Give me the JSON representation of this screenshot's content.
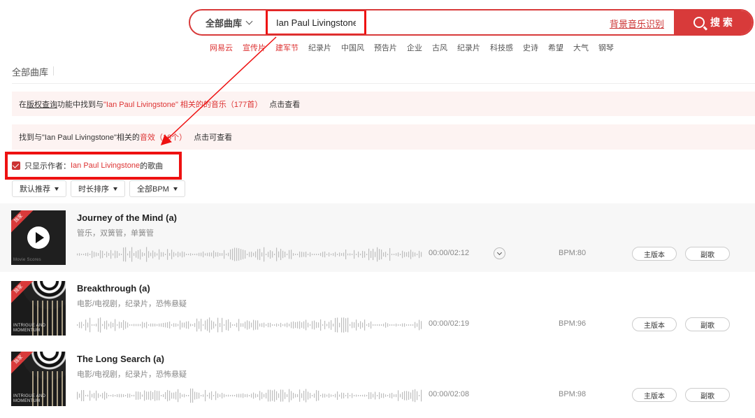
{
  "search": {
    "library_label": "全部曲库",
    "query": "Ian Paul Livingstone",
    "beat_link": "背景音乐识别",
    "button_label": "搜 索"
  },
  "hot_tags": [
    "网易云",
    "宣传片",
    "建军节",
    "纪录片",
    "中国风",
    "预告片",
    "企业",
    "古风",
    "纪录片",
    "科技感",
    "史诗",
    "希望",
    "大气",
    "钢琴"
  ],
  "section_title": "全部曲库",
  "notice_copyright": {
    "prefix": "在 ",
    "link": "版权查询",
    "middle": " 功能中找到与 ",
    "highlight": "\"Ian Paul Livingstone\" 相关的的音乐（177首）",
    "action": "点击查看"
  },
  "notice_sfx": {
    "prefix": "找到与\"Ian Paul Livingstone\"相关的 ",
    "highlight": "音效（16个）",
    "action": "点击可查看"
  },
  "only_author": {
    "prefix": "只显示作者：",
    "author": "Ian Paul Livingstone",
    "suffix": "的歌曲",
    "checked": true
  },
  "filters": [
    "默认推荐",
    "时长排序",
    "全部BPM"
  ],
  "tracks": [
    {
      "title": "Journey of the Mind (a)",
      "tags": "管乐，双簧管，单簧管",
      "time": "00:00/02:12",
      "bpm": "BPM:80",
      "main_label": "主版本",
      "sub_label": "副歌",
      "ribbon": "独家",
      "cover_text": "Movie Scores",
      "active": true
    },
    {
      "title": "Breakthrough (a)",
      "tags": "电影/电视剧，纪录片，恐怖悬疑",
      "time": "00:00/02:19",
      "bpm": "BPM:96",
      "main_label": "主版本",
      "sub_label": "副歌",
      "ribbon": "独家",
      "cover_text": "INTRIGUE AND MOMENTUM",
      "active": false
    },
    {
      "title": "The Long Search (a)",
      "tags": "电影/电视剧，纪录片，恐怖悬疑",
      "time": "00:00/02:08",
      "bpm": "BPM:98",
      "main_label": "主版本",
      "sub_label": "副歌",
      "ribbon": "独家",
      "cover_text": "INTRIGUE AND MOMENTUM",
      "active": false
    }
  ],
  "colors": {
    "accent": "#d83a3a",
    "annotation": "#ee1111"
  }
}
